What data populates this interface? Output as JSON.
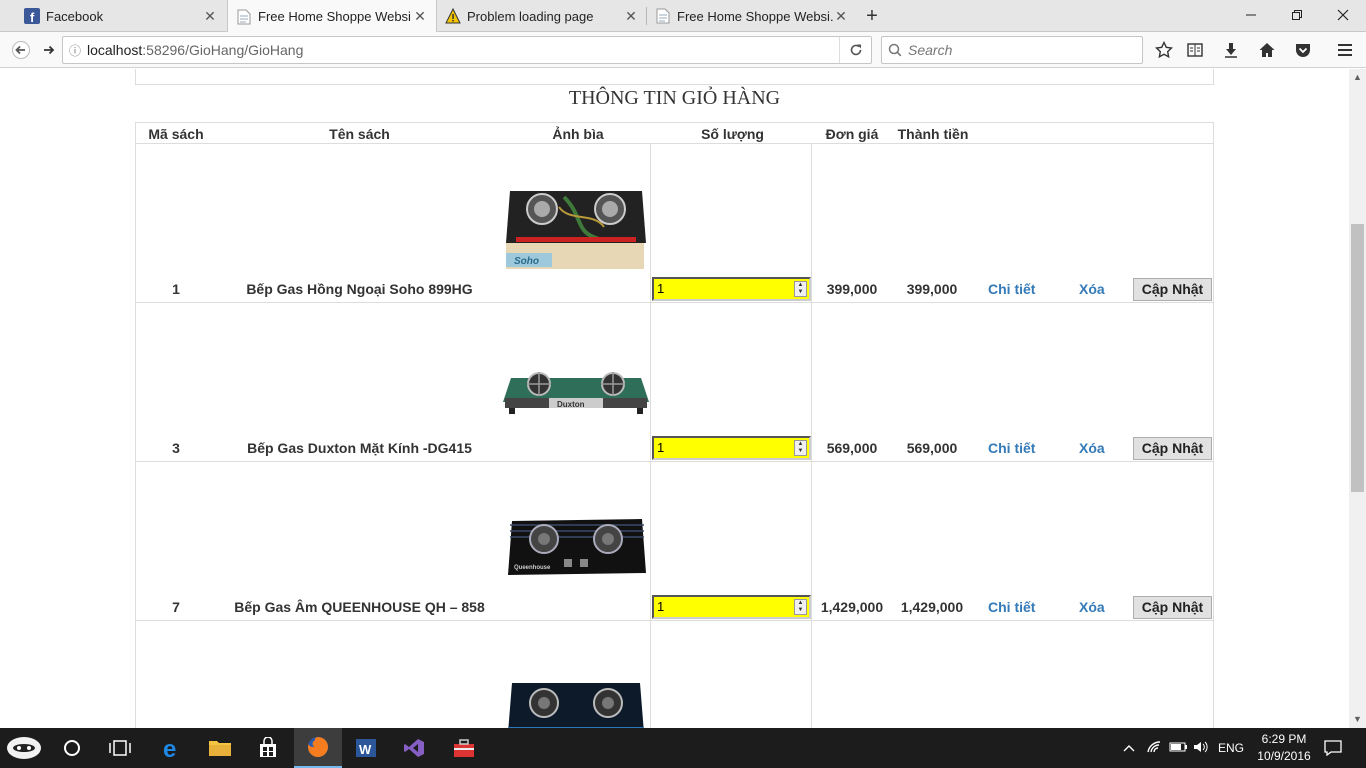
{
  "browser": {
    "tabs": [
      {
        "title": "Facebook",
        "icon": "facebook-icon"
      },
      {
        "title": "Free Home Shoppe Websi...",
        "icon": "page-icon"
      },
      {
        "title": "Problem loading page",
        "icon": "warning-icon"
      },
      {
        "title": "Free Home Shoppe Websi...",
        "icon": "page-icon"
      }
    ],
    "url_host": "localhost",
    "url_path": ":58296/GioHang/GioHang",
    "search_placeholder": "Search"
  },
  "page": {
    "title": "THÔNG TIN GIỎ HÀNG",
    "columns": [
      "Mã sách",
      "Tên sách",
      "Ảnh bìa",
      "Số lượng",
      "Đơn giá",
      "Thành tiền"
    ],
    "rows": [
      {
        "code": "1",
        "name": "Bếp Gas Hồng Ngoại Soho 899HG",
        "qty": "1",
        "price": "399,000",
        "total": "399,000",
        "detail": "Chi tiết",
        "delete": "Xóa",
        "update": "Cập Nhật",
        "image": "gas-stove-soho"
      },
      {
        "code": "3",
        "name": "Bếp Gas Duxton Mặt Kính -DG415",
        "qty": "1",
        "price": "569,000",
        "total": "569,000",
        "detail": "Chi tiết",
        "delete": "Xóa",
        "update": "Cập Nhật",
        "image": "gas-stove-duxton"
      },
      {
        "code": "7",
        "name": "Bếp Gas Âm QUEENHOUSE QH – 858",
        "qty": "1",
        "price": "1,429,000",
        "total": "1,429,000",
        "detail": "Chi tiết",
        "delete": "Xóa",
        "update": "Cập Nhật",
        "image": "gas-stove-queenhouse"
      }
    ]
  },
  "taskbar": {
    "language": "ENG",
    "time": "6:29 PM",
    "date": "10/9/2016"
  }
}
